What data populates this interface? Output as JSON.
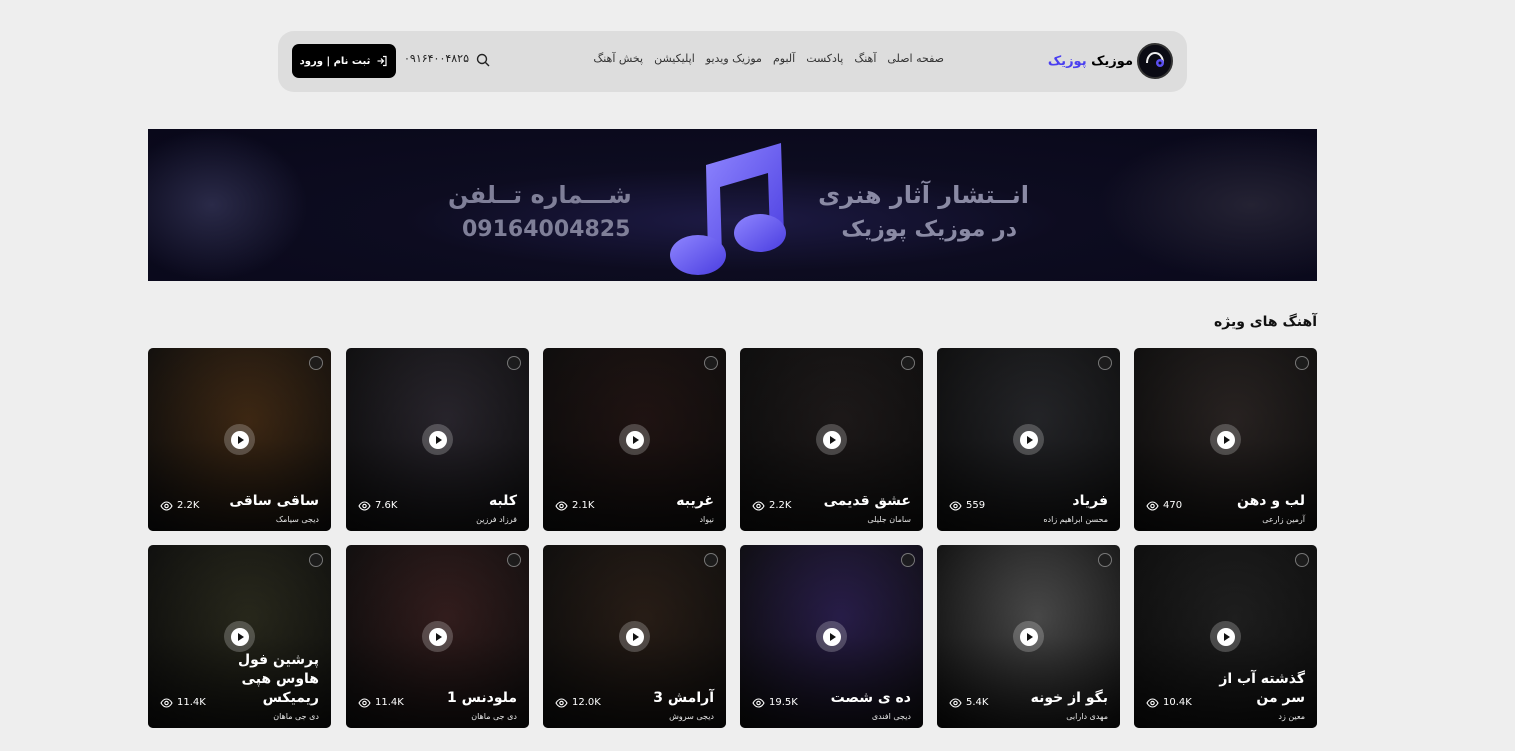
{
  "header": {
    "brand_main": "موزیک ",
    "brand_accent": "پوزیک",
    "nav": [
      "صفحه اصلی",
      "آهنگ",
      "پادکست",
      "آلبوم",
      "موزیک ویدیو",
      "اپلیکیشن",
      "پخش آهنگ"
    ],
    "phone": "۰۹۱۶۴۰۰۴۸۲۵",
    "login_label": "ثبت نام | ورود"
  },
  "banner": {
    "line1": "انــتشار آثار هنری",
    "line2": "در موزیک پوزیک",
    "phone_title": "شـــماره تــلفن",
    "phone_number": "09164004825",
    "accent_color": "#6a5cf5"
  },
  "section": {
    "title": "آهنگ های ویژه"
  },
  "songs": [
    {
      "title": "لب و دهن",
      "artist": "آرمین زارعی",
      "views": "470",
      "color": "#3a3230"
    },
    {
      "title": "فریاد",
      "artist": "محسن ابراهیم زاده",
      "views": "559",
      "color": "#34353a"
    },
    {
      "title": "عشق قدیمی",
      "artist": "سامان جلیلی",
      "views": "2.2K",
      "color": "#2a2424"
    },
    {
      "title": "غریبه",
      "artist": "نیواد",
      "views": "2.1K",
      "color": "#2e1c1a"
    },
    {
      "title": "کلبه",
      "artist": "فرزاد فرزین",
      "views": "7.6K",
      "color": "#3a3540"
    },
    {
      "title": "ساقی ساقی",
      "artist": "دیجی سیامک",
      "views": "2.2K",
      "color": "#5a3a1c"
    },
    {
      "title": "گذشته آب از سر من",
      "artist": "معین زد",
      "views": "10.4K",
      "color": "#2c2c2c"
    },
    {
      "title": "بگو از خونه",
      "artist": "مهدی دارابی",
      "views": "5.4K",
      "color": "#6a6a6a"
    },
    {
      "title": "ده ی شصت",
      "artist": "دیجی افندی",
      "views": "19.5K",
      "color": "#3a2a6a"
    },
    {
      "title": "آرامش 3",
      "artist": "دیجی سروش",
      "views": "12.0K",
      "color": "#3a2a20"
    },
    {
      "title": "ملودنس 1",
      "artist": "دی جی ماهان",
      "views": "11.4K",
      "color": "#4a2a2a"
    },
    {
      "title": "پرشین فول هاوس هپی ریمیکس",
      "artist": "دی جی ماهان",
      "views": "11.4K",
      "color": "#3a3a28"
    }
  ]
}
